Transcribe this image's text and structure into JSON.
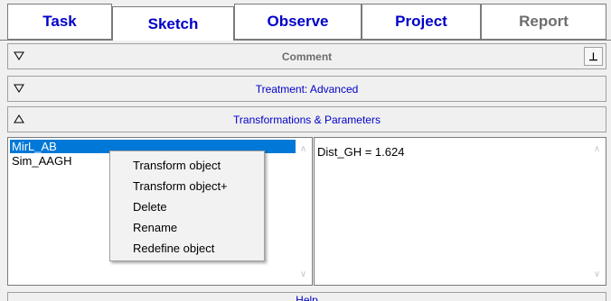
{
  "tabs": [
    {
      "label": "Task"
    },
    {
      "label": "Sketch"
    },
    {
      "label": "Observe"
    },
    {
      "label": "Project"
    },
    {
      "label": "Report"
    }
  ],
  "sections": {
    "comment": {
      "label": "Comment",
      "pin": "⊥"
    },
    "treatment": {
      "label": "Treatment: Advanced"
    },
    "transformations": {
      "label": "Transformations & Parameters"
    },
    "help": {
      "label": "Help"
    }
  },
  "object_list": {
    "items": [
      "MirL_AB",
      "Sim_AAGH"
    ],
    "selected": "MirL_AB"
  },
  "parameters": {
    "text": "Dist_GH = 1.624"
  },
  "context_menu": {
    "items": [
      "Transform object",
      "Transform object+",
      "Delete",
      "Rename",
      "Redefine object"
    ]
  },
  "colors": {
    "tab_text": "#0000c8",
    "disabled_text": "#6d6d6d",
    "selection": "#0078d7"
  }
}
